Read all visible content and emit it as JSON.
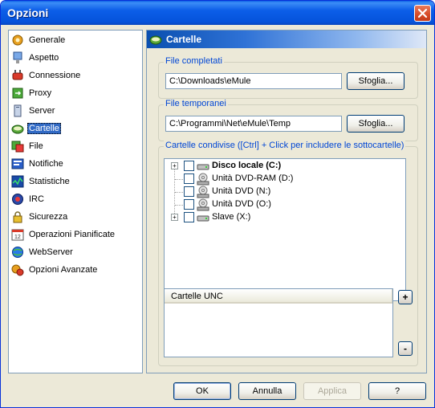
{
  "window": {
    "title": "Opzioni"
  },
  "nav": {
    "items": [
      {
        "label": "Generale",
        "icon": "gear-icon"
      },
      {
        "label": "Aspetto",
        "icon": "monitor-icon"
      },
      {
        "label": "Connessione",
        "icon": "plug-icon"
      },
      {
        "label": "Proxy",
        "icon": "proxy-icon"
      },
      {
        "label": "Server",
        "icon": "server-icon"
      },
      {
        "label": "Cartelle",
        "icon": "folder-icon",
        "selected": true
      },
      {
        "label": "File",
        "icon": "file-icon"
      },
      {
        "label": "Notifiche",
        "icon": "notification-icon"
      },
      {
        "label": "Statistiche",
        "icon": "statistics-icon"
      },
      {
        "label": "IRC",
        "icon": "irc-icon"
      },
      {
        "label": "Sicurezza",
        "icon": "lock-icon"
      },
      {
        "label": "Operazioni Pianificate",
        "icon": "calendar-icon"
      },
      {
        "label": "WebServer",
        "icon": "globe-icon"
      },
      {
        "label": "Opzioni Avanzate",
        "icon": "advanced-gear-icon"
      }
    ]
  },
  "panel": {
    "title": "Cartelle",
    "completed": {
      "legend": "File completati",
      "path": "C:\\Downloads\\eMule",
      "browse": "Sfoglia..."
    },
    "temp": {
      "legend": "File temporanei",
      "path": "C:\\Programmi\\Net\\eMule\\Temp",
      "browse": "Sfoglia..."
    },
    "shared": {
      "legend": "Cartelle condivise ([Ctrl] + Click per includere le sottocartelle)",
      "tree": [
        {
          "label": "Disco locale (C:)",
          "bold": true,
          "expandable": true,
          "icon": "hard-drive-icon"
        },
        {
          "label": "Unità DVD-RAM (D:)",
          "bold": false,
          "expandable": false,
          "icon": "dvd-drive-icon"
        },
        {
          "label": "Unità DVD (N:)",
          "bold": false,
          "expandable": false,
          "icon": "dvd-drive-icon"
        },
        {
          "label": "Unità DVD (O:)",
          "bold": false,
          "expandable": false,
          "icon": "dvd-drive-icon"
        },
        {
          "label": "Slave (X:)",
          "bold": false,
          "expandable": true,
          "icon": "hard-drive-icon"
        }
      ],
      "unc_header": "Cartelle UNC",
      "add": "+",
      "remove": "-"
    }
  },
  "buttons": {
    "ok": "OK",
    "cancel": "Annulla",
    "apply": "Applica",
    "help": "?"
  }
}
